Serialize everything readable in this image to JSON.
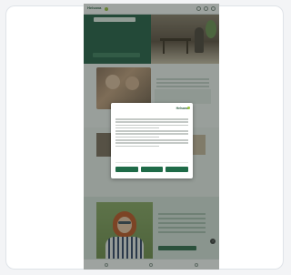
{
  "site": {
    "logo": "Helsana"
  },
  "hero": {
    "tag": "",
    "title": "",
    "cta": ""
  },
  "section2": {
    "title": ""
  },
  "section4": {
    "title": ""
  },
  "consent": {
    "logo": "Helsana",
    "title": "",
    "buttons": [
      "",
      "",
      ""
    ]
  },
  "icons": {
    "nav": [
      "search-icon",
      "account-icon",
      "menu-icon"
    ],
    "bottom": [
      "home-icon",
      "chat-icon",
      "profile-icon"
    ],
    "carousel_next": "chevron-right-icon"
  },
  "colors": {
    "brand_green": "#1f5c42",
    "accent_lime": "#9bc53d"
  }
}
